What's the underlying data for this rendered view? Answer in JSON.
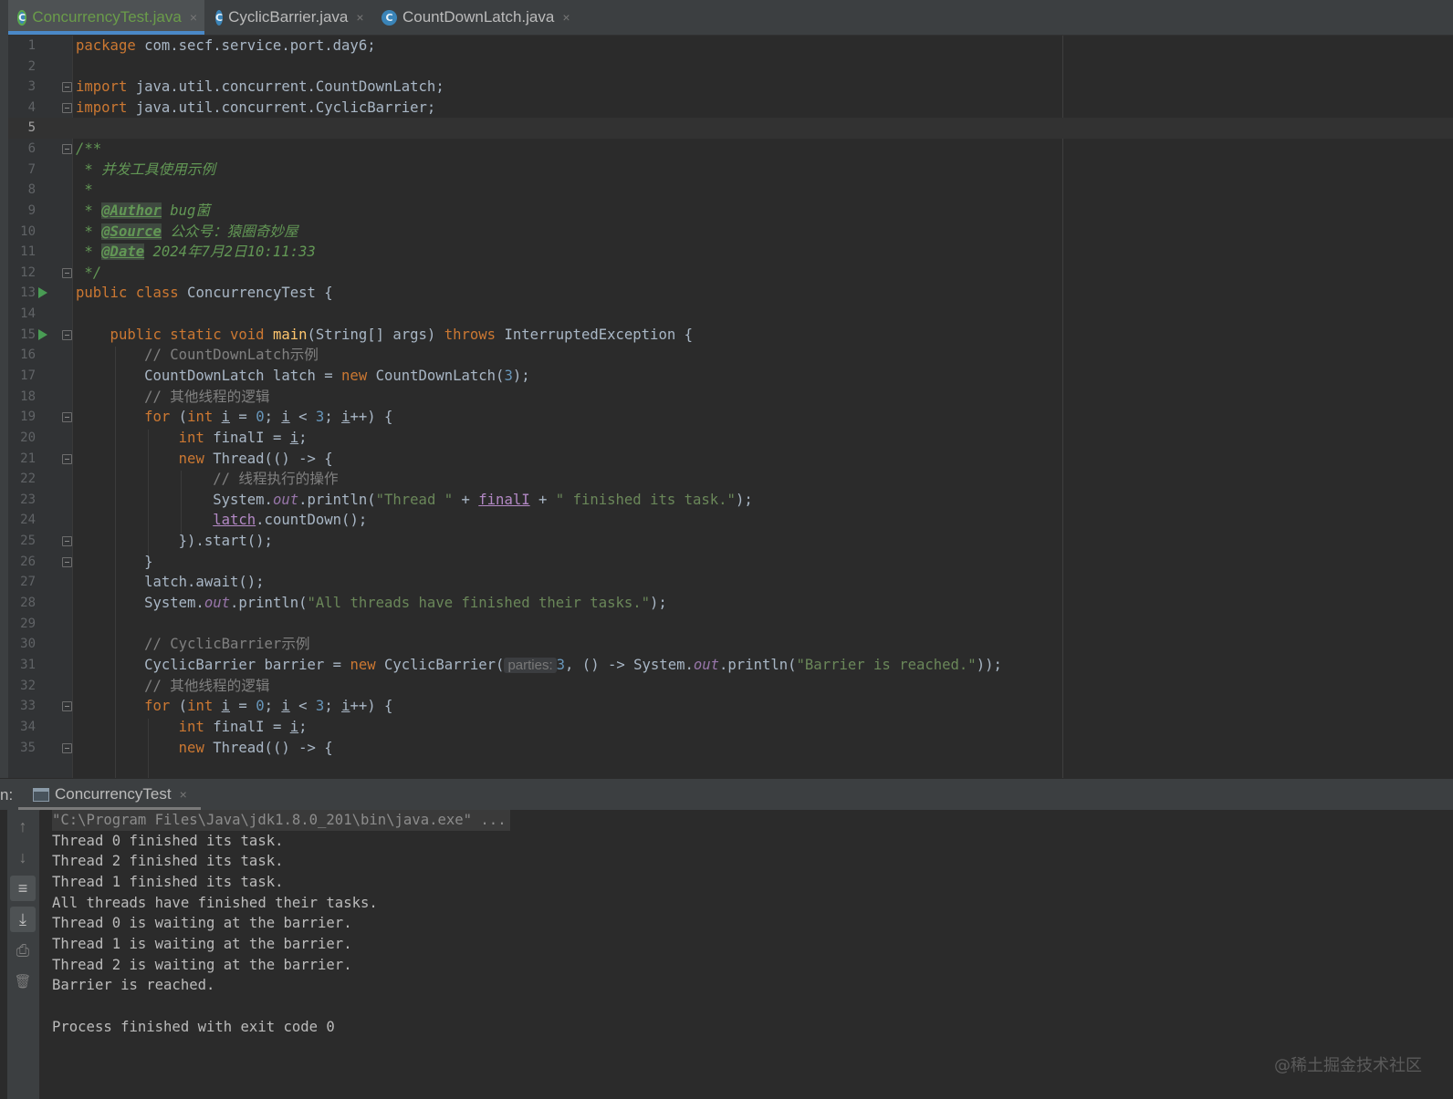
{
  "tabs": [
    {
      "label": "ConcurrencyTest.java",
      "icon": "class-icon",
      "active": true
    },
    {
      "label": "CyclicBarrier.java",
      "icon": "class-icon",
      "active": false
    },
    {
      "label": "CountDownLatch.java",
      "icon": "class-icon",
      "active": false
    }
  ],
  "tab_icon_letter": "C",
  "close_glyph": "×",
  "editor": {
    "line_numbers": [
      "1",
      "2",
      "3",
      "4",
      "5",
      "6",
      "7",
      "8",
      "9",
      "10",
      "11",
      "12",
      "13",
      "14",
      "15",
      "16",
      "17",
      "18",
      "19",
      "20",
      "21",
      "22",
      "23",
      "24",
      "25",
      "26",
      "27",
      "28",
      "29",
      "30",
      "31",
      "32",
      "33",
      "34",
      "35"
    ],
    "current_line": "5",
    "code": {
      "l1_kw": "package",
      "l1_rest": " com.secf.service.port.day6;",
      "l3_kw": "import",
      "l3_rest": " java.util.concurrent.CountDownLatch;",
      "l4_kw": "import",
      "l4_rest": " java.util.concurrent.CyclicBarrier;",
      "l6": "/**",
      "l7": " * 并发工具使用示例",
      "l8": " *",
      "l9_pre": " * ",
      "l9_tag": "@Author",
      "l9_val": " bug菌",
      "l10_pre": " * ",
      "l10_tag": "@Source",
      "l10_val": " 公众号：猿圈奇妙屋",
      "l11_pre": " * ",
      "l11_tag": "@Date",
      "l11_val": " 2024年7月2日10:11:33",
      "l12": " */",
      "l13_kw": "public class",
      "l13_rest": " ConcurrencyTest {",
      "l15_kw": "    public static void ",
      "l15_fn": "main",
      "l15_mid": "(String[] args) ",
      "l15_kw2": "throws",
      "l15_rest": " InterruptedException {",
      "l16": "        // CountDownLatch示例",
      "l17_a": "        CountDownLatch latch = ",
      "l17_kw": "new",
      "l17_b": " CountDownLatch(",
      "l17_num": "3",
      "l17_c": ");",
      "l18": "        // 其他线程的逻辑",
      "l19_a": "        ",
      "l19_kw": "for",
      "l19_b": " (",
      "l19_kw2": "int",
      "l19_c": " ",
      "l19_i1": "i",
      "l19_d": " = ",
      "l19_n0": "0",
      "l19_e": "; ",
      "l19_i2": "i",
      "l19_f": " < ",
      "l19_n3": "3",
      "l19_g": "; ",
      "l19_i3": "i",
      "l19_h": "++) {",
      "l20_a": "            ",
      "l20_kw": "int",
      "l20_b": " finalI = ",
      "l20_i": "i",
      "l20_c": ";",
      "l21_a": "            ",
      "l21_kw": "new",
      "l21_b": " Thread(() -> {",
      "l22": "                // 线程执行的操作",
      "l23_a": "                System.",
      "l23_out": "out",
      "l23_b": ".println(",
      "l23_s1": "\"Thread \"",
      "l23_c": " + ",
      "l23_v": "finalI",
      "l23_d": " + ",
      "l23_s2": "\" finished its task.\"",
      "l23_e": ");",
      "l24_a": "                ",
      "l24_v": "latch",
      "l24_b": ".countDown();",
      "l25": "            }).start();",
      "l26": "        }",
      "l27": "        latch.await();",
      "l28_a": "        System.",
      "l28_out": "out",
      "l28_b": ".println(",
      "l28_s": "\"All threads have finished their tasks.\"",
      "l28_c": ");",
      "l30": "        // CyclicBarrier示例",
      "l31_a": "        CyclicBarrier barrier = ",
      "l31_kw": "new",
      "l31_b": " CyclicBarrier(",
      "l31_hint": "parties:",
      "l31_num": "3",
      "l31_c": ", () -> System.",
      "l31_out": "out",
      "l31_d": ".println(",
      "l31_s": "\"Barrier is reached.\"",
      "l31_e": "));",
      "l32": "        // 其他线程的逻辑",
      "l33_a": "        ",
      "l33_kw": "for",
      "l33_b": " (",
      "l33_kw2": "int",
      "l33_c": " ",
      "l33_i1": "i",
      "l33_d": " = ",
      "l33_n0": "0",
      "l33_e": "; ",
      "l33_i2": "i",
      "l33_f": " < ",
      "l33_n3": "3",
      "l33_g": "; ",
      "l33_i3": "i",
      "l33_h": "++) {",
      "l34_a": "            ",
      "l34_kw": "int",
      "l34_b": " finalI = ",
      "l34_i": "i",
      "l34_c": ";",
      "l35_a": "            ",
      "l35_kw": "new",
      "l35_b": " Thread(() -> {"
    }
  },
  "run_panel": {
    "label": "n:",
    "tab_label": "ConcurrencyTest",
    "toolbar": [
      {
        "name": "up-arrow-icon",
        "glyph": "↑"
      },
      {
        "name": "down-arrow-icon",
        "glyph": "↓"
      },
      {
        "name": "soft-wrap-icon",
        "glyph": "≡"
      },
      {
        "name": "scroll-to-end-icon",
        "glyph": "⤓"
      },
      {
        "name": "print-icon",
        "glyph": "⎙"
      },
      {
        "name": "trash-icon",
        "glyph": "🗑"
      }
    ],
    "console_lines": [
      "\"C:\\Program Files\\Java\\jdk1.8.0_201\\bin\\java.exe\" ...",
      "Thread 0 finished its task.",
      "Thread 2 finished its task.",
      "Thread 1 finished its task.",
      "All threads have finished their tasks.",
      "Thread 0 is waiting at the barrier.",
      "Thread 1 is waiting at the barrier.",
      "Thread 2 is waiting at the barrier.",
      "Barrier is reached.",
      "",
      "Process finished with exit code 0"
    ]
  },
  "watermark": "@稀土掘金技术社区",
  "colors": {
    "keyword": "#cc7832",
    "string": "#6a8759",
    "number": "#6897bb",
    "comment": "#808080",
    "doc_comment": "#629755",
    "method": "#ffc66d",
    "static_field": "#9876aa",
    "background": "#2b2b2b"
  }
}
